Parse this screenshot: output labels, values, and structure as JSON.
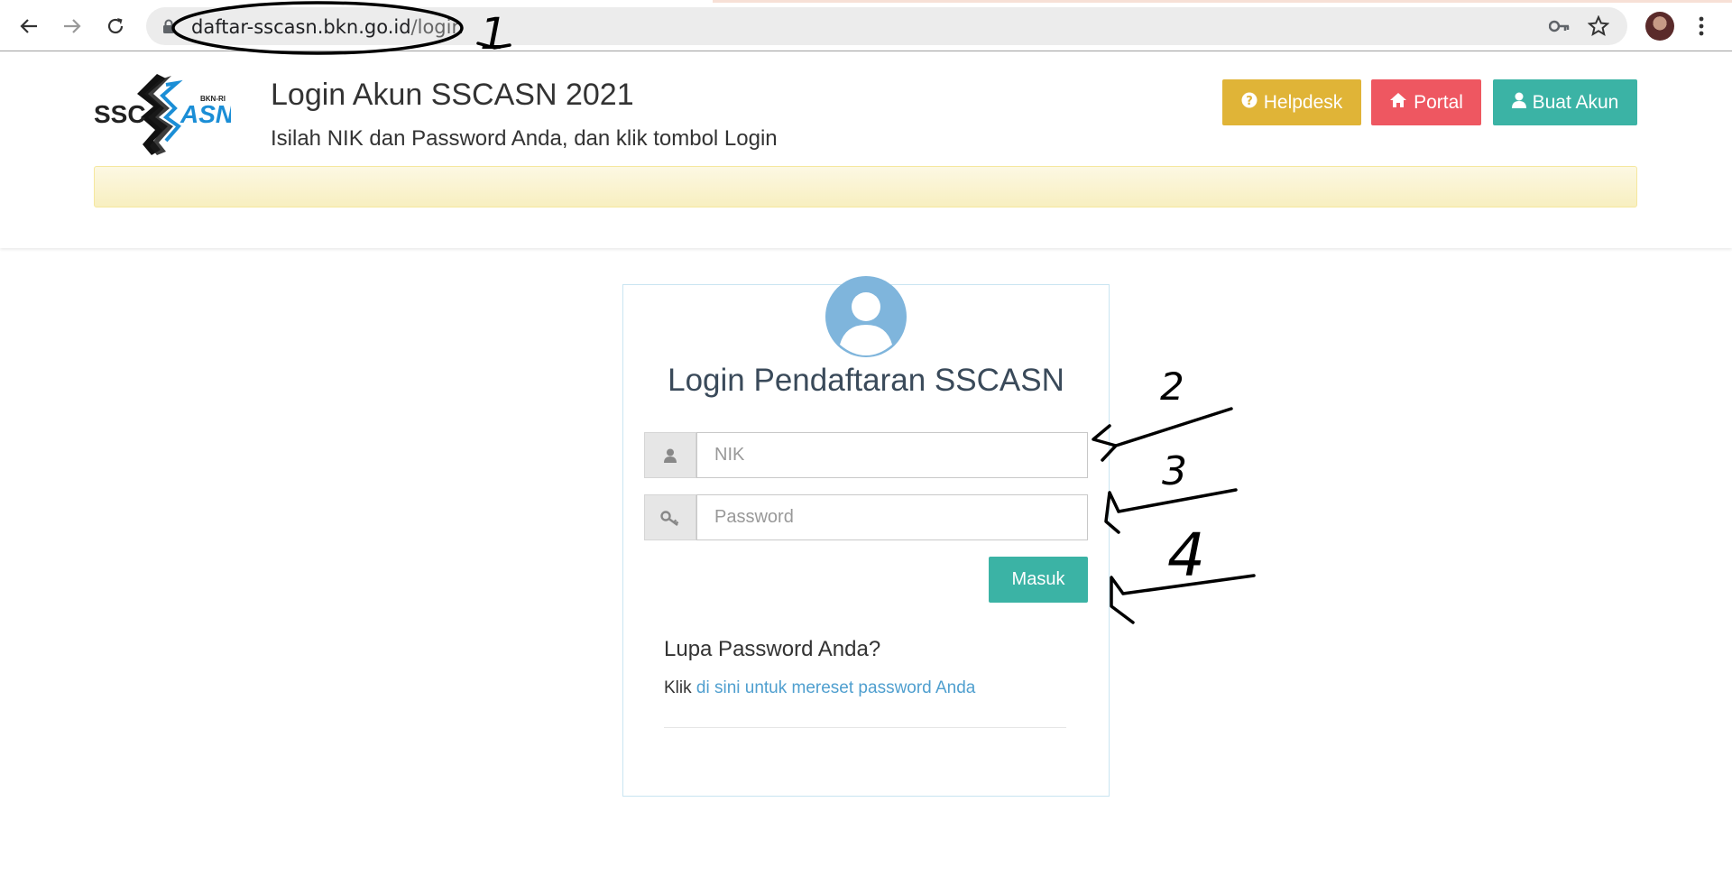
{
  "browser": {
    "url_host": "daftar-sscasn.bkn.go.id",
    "url_path": "/login",
    "icons": [
      "back-arrow-icon",
      "forward-arrow-icon",
      "reload-icon",
      "lock-icon",
      "key-icon",
      "star-icon",
      "avatar",
      "kebab-menu-icon"
    ]
  },
  "header": {
    "logo_text_left": "SSC",
    "logo_text_right": "ASN",
    "logo_small": "BKN-RI",
    "title": "Login Akun SSCASN 2021",
    "subtitle": "Isilah NIK dan Password Anda, dan klik tombol Login",
    "buttons": [
      {
        "label": "Helpdesk",
        "icon": "question-circle-icon",
        "color": "#e0b437"
      },
      {
        "label": "Portal",
        "icon": "home-icon",
        "color": "#ee5761"
      },
      {
        "label": "Buat Akun",
        "icon": "user-icon",
        "color": "#3bb3a5"
      }
    ]
  },
  "login": {
    "title": "Login Pendaftaran SSCASN",
    "nik_placeholder": "NIK",
    "password_placeholder": "Password",
    "submit_label": "Masuk",
    "forgot_heading": "Lupa Password Anda?",
    "forgot_prefix": "Klik",
    "forgot_link": "di sini untuk mereset password Anda"
  },
  "annotations": [
    "1",
    "2",
    "3",
    "4"
  ],
  "colors": {
    "accent_teal": "#3bb3a5",
    "helpdesk_yellow": "#e0b437",
    "portal_red": "#ee5761",
    "avatar_blue": "#7fb5dc",
    "link_blue": "#4f9fcf"
  }
}
